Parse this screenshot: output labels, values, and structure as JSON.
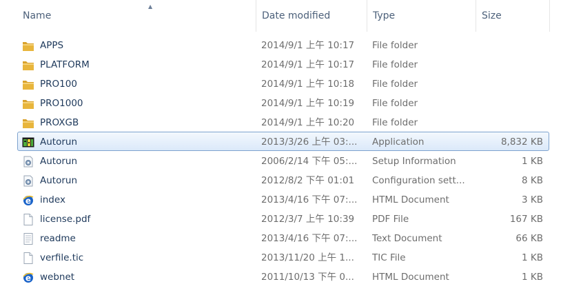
{
  "columns": {
    "name": "Name",
    "date": "Date modified",
    "type": "Type",
    "size": "Size"
  },
  "rows": [
    {
      "name": "APPS",
      "date": "2014/9/1 上午 10:17",
      "type": "File folder",
      "size": "",
      "icon": "folder-icon",
      "selected": false
    },
    {
      "name": "PLATFORM",
      "date": "2014/9/1 上午 10:17",
      "type": "File folder",
      "size": "",
      "icon": "folder-icon",
      "selected": false
    },
    {
      "name": "PRO100",
      "date": "2014/9/1 上午 10:18",
      "type": "File folder",
      "size": "",
      "icon": "folder-icon",
      "selected": false
    },
    {
      "name": "PRO1000",
      "date": "2014/9/1 上午 10:19",
      "type": "File folder",
      "size": "",
      "icon": "folder-icon",
      "selected": false
    },
    {
      "name": "PROXGB",
      "date": "2014/9/1 上午 10:20",
      "type": "File folder",
      "size": "",
      "icon": "folder-icon",
      "selected": false
    },
    {
      "name": "Autorun",
      "date": "2013/3/26 上午 03:...",
      "type": "Application",
      "size": "8,832 KB",
      "icon": "application-icon",
      "selected": true
    },
    {
      "name": "Autorun",
      "date": "2006/2/14 下午 05:...",
      "type": "Setup Information",
      "size": "1 KB",
      "icon": "settings-file-icon",
      "selected": false
    },
    {
      "name": "Autorun",
      "date": "2012/8/2 下午 01:01",
      "type": "Configuration sett...",
      "size": "8 KB",
      "icon": "settings-file-icon",
      "selected": false
    },
    {
      "name": "index",
      "date": "2013/4/16 下午 07:...",
      "type": "HTML Document",
      "size": "3 KB",
      "icon": "ie-icon",
      "selected": false
    },
    {
      "name": "license.pdf",
      "date": "2012/3/7 上午 10:39",
      "type": "PDF File",
      "size": "167 KB",
      "icon": "blank-file-icon",
      "selected": false
    },
    {
      "name": "readme",
      "date": "2013/4/16 下午 07:...",
      "type": "Text Document",
      "size": "66 KB",
      "icon": "text-file-icon",
      "selected": false
    },
    {
      "name": "verfile.tic",
      "date": "2013/11/20 上午 1...",
      "type": "TIC File",
      "size": "1 KB",
      "icon": "blank-file-icon",
      "selected": false
    },
    {
      "name": "webnet",
      "date": "2011/10/13 下午 0...",
      "type": "HTML Document",
      "size": "1 KB",
      "icon": "ie-icon",
      "selected": false
    }
  ],
  "colors": {
    "folder": "#e8b53c",
    "selection_border": "#7da2ce",
    "name_text": "#1e395b",
    "detail_text": "#6d6d6d",
    "ie_blue": "#1a63c9"
  }
}
